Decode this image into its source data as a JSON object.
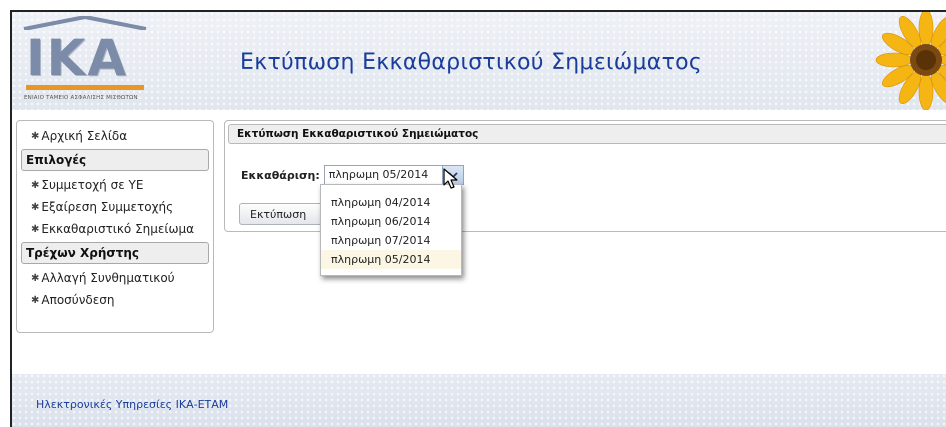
{
  "header": {
    "title": "Εκτύπωση Εκκαθαριστικού Σημειώματος",
    "logo_text": "ΙΚΑ",
    "logo_subtitle": "ΕΝΙΑΙΟ ΤΑΜΕΙΟ ΑΣΦΑΛΙΣΗΣ ΜΙΣΘΩΤΩΝ"
  },
  "sidebar": {
    "home": "Αρχική Σελίδα",
    "section_options": "Επιλογές",
    "participation": "Συμμετοχή σε ΥΕ",
    "exemption": "Εξαίρεση Συμμετοχής",
    "statement": "Εκκαθαριστικό Σημείωμα",
    "section_user": "Τρέχων Χρήστης",
    "change_password": "Αλλαγή Συνθηματικού",
    "logout": "Αποσύνδεση"
  },
  "panel": {
    "title": "Εκτύπωση Εκκαθαριστικού Σημειώματος",
    "field_label": "Εκκαθάριση:",
    "selected_value": "πληρωμη 05/2014",
    "print_button": "Εκτύπωση"
  },
  "dropdown": {
    "options": [
      "πληρωμη 04/2014",
      "πληρωμη 06/2014",
      "πληρωμη 07/2014",
      "πληρωμη 05/2014"
    ]
  },
  "footer": {
    "text": "Ηλεκτρονικές Υπηρεσίες ΙΚΑ-ΕΤΑΜ"
  },
  "colors": {
    "heading": "#1a3d9a",
    "logo": "#7c8ba8",
    "logo_bar": "#e8962a",
    "selected_option_bg": "#fbf7e4"
  }
}
